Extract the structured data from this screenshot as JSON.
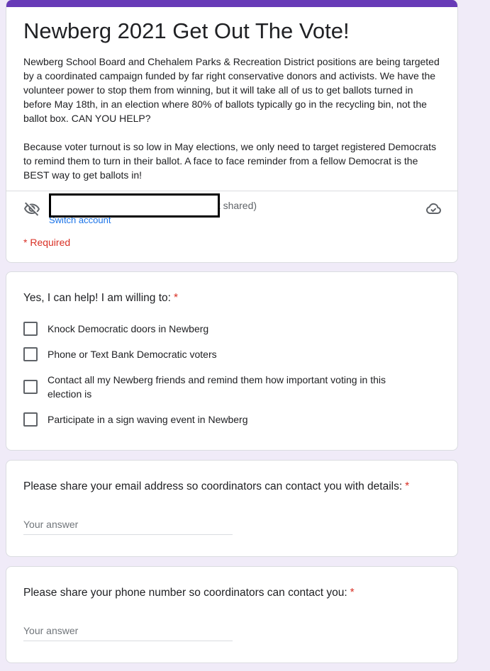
{
  "header": {
    "title": "Newberg 2021 Get Out The Vote!",
    "description": [
      "Newberg School Board and Chehalem Parks & Recreation District positions are being targeted by a coordinated campaign funded by far right conservative donors and activists. We have the volunteer power to stop them from winning, but it will take all of us to get ballots turned in before May 18th, in an election where 80% of ballots typically go in the recycling bin, not the ballot box.  CAN YOU HELP?",
      "Because voter turnout is so low in May elections, we only need to target registered Democrats to remind them to turn in their ballot.  A face to face reminder from a fellow Democrat is the BEST way to get ballots in!"
    ],
    "account_status_fragment": "ot shared)",
    "switch_account": "Switch account",
    "required_note": "* Required",
    "accent_color": "#673ab7",
    "icons": {
      "visibility": "eye-off-icon",
      "save_status": "cloud-check-icon"
    }
  },
  "questions": {
    "help": {
      "title": "Yes, I can help! I am willing to:",
      "required_mark": "*",
      "options": [
        "Knock Democratic doors in Newberg",
        "Phone or Text Bank Democratic voters",
        "Contact all my Newberg friends and remind them how important voting in this election is",
        "Participate in a sign waving event in Newberg"
      ]
    },
    "email": {
      "title": "Please share your email address so coordinators can contact you with details:",
      "required_mark": "*",
      "placeholder": "Your answer"
    },
    "phone": {
      "title": "Please share your phone number so coordinators can contact you:",
      "required_mark": "*",
      "placeholder": "Your answer"
    }
  },
  "colors": {
    "background": "#f0ebf8",
    "required": "#d93025",
    "link": "#1a73e8"
  }
}
